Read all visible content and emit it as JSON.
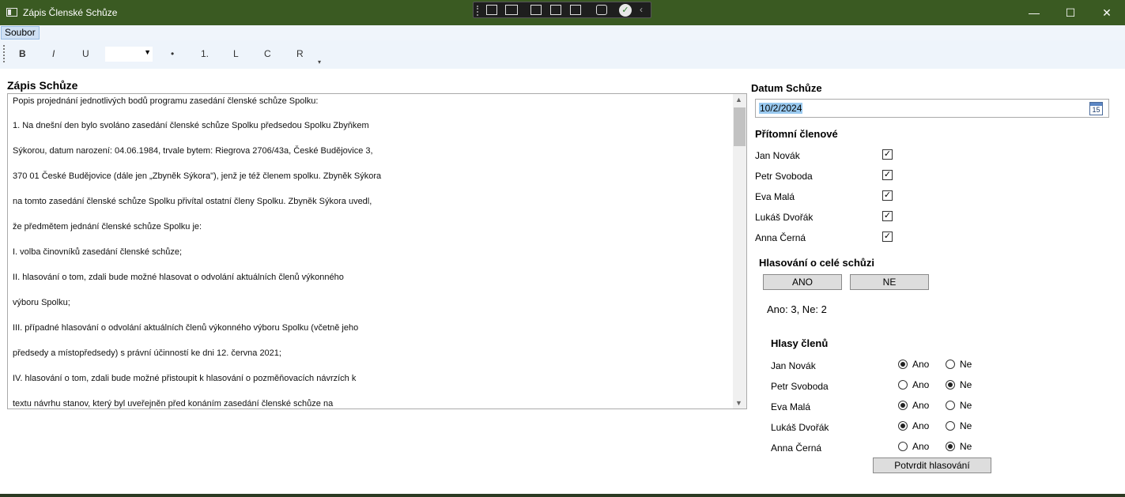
{
  "window": {
    "title": "Zápis Členské Schůze",
    "minimize_glyph": "—",
    "maximize_glyph": "☐",
    "close_glyph": "✕",
    "titlebar_color": "#3a5a22"
  },
  "menu": {
    "items": [
      {
        "label": "Soubor"
      }
    ]
  },
  "toolbar": {
    "bold": "B",
    "italic": "I",
    "underline": "U",
    "font_size_value": "",
    "bullets": "•",
    "numbering": "1.",
    "align_left": "L",
    "align_center": "C",
    "align_right": "R",
    "overflow": "▾"
  },
  "editor": {
    "heading": "Zápis Schůze",
    "lines": [
      "Popis projednání jednotlivých bodů programu zasedání členské schůze Spolku:",
      "1. Na dnešní den bylo svoláno zasedání členské schůze Spolku předsedou Spolku Zbyňkem",
      "Sýkorou, datum narození: 04.06.1984, trvale bytem: Riegrova 2706/43a, České Budějovice 3,",
      "370 01 České Budějovice (dále jen „Zbyněk Sýkora\"), jenž je též členem spolku. Zbyněk Sýkora",
      "na tomto zasedání členské schůze Spolku přivítal ostatní členy Spolku. Zbyněk Sýkora uvedl,",
      "že předmětem jednání členské schůze Spolku je:",
      "I. volba činovníků zasedání členské schůze;",
      "II. hlasování o tom, zdali bude možné hlasovat o odvolání aktuálních členů výkonného",
      "výboru Spolku;",
      "III. případné hlasování o odvolání aktuálních členů výkonného výboru Spolku (včetně jeho",
      "předsedy a místopředsedy) s právní účinností ke dni 12. června 2021;",
      "IV. hlasování o tom, zdali bude možné přistoupit k hlasování o pozměňovacích návrzích k",
      "textu návrhu stanov, který byl uveřejněn před konáním zasedání členské schůze na"
    ]
  },
  "date": {
    "heading": "Datum Schůze",
    "value": "10/2/2024",
    "calendar_day": "15"
  },
  "members": {
    "heading": "Přítomní členové",
    "items": [
      {
        "name": "Jan Novák",
        "checked": true
      },
      {
        "name": "Petr Svoboda",
        "checked": true
      },
      {
        "name": "Eva Malá",
        "checked": true
      },
      {
        "name": "Lukáš Dvořák",
        "checked": true
      },
      {
        "name": "Anna Černá",
        "checked": true
      }
    ]
  },
  "meeting_vote": {
    "heading": "Hlasování o celé schůzi",
    "yes_label": "ANO",
    "no_label": "NE",
    "tally": "Ano: 3, Ne: 2"
  },
  "member_votes": {
    "heading": "Hlasy členů",
    "yes_label": "Ano",
    "no_label": "Ne",
    "items": [
      {
        "name": "Jan Novák",
        "vote": "Ano"
      },
      {
        "name": "Petr Svoboda",
        "vote": "Ne"
      },
      {
        "name": "Eva Malá",
        "vote": "Ano"
      },
      {
        "name": "Lukáš Dvořák",
        "vote": "Ano"
      },
      {
        "name": "Anna Černá",
        "vote": "Ne"
      }
    ],
    "confirm_label": "Potvrdit hlasování"
  }
}
